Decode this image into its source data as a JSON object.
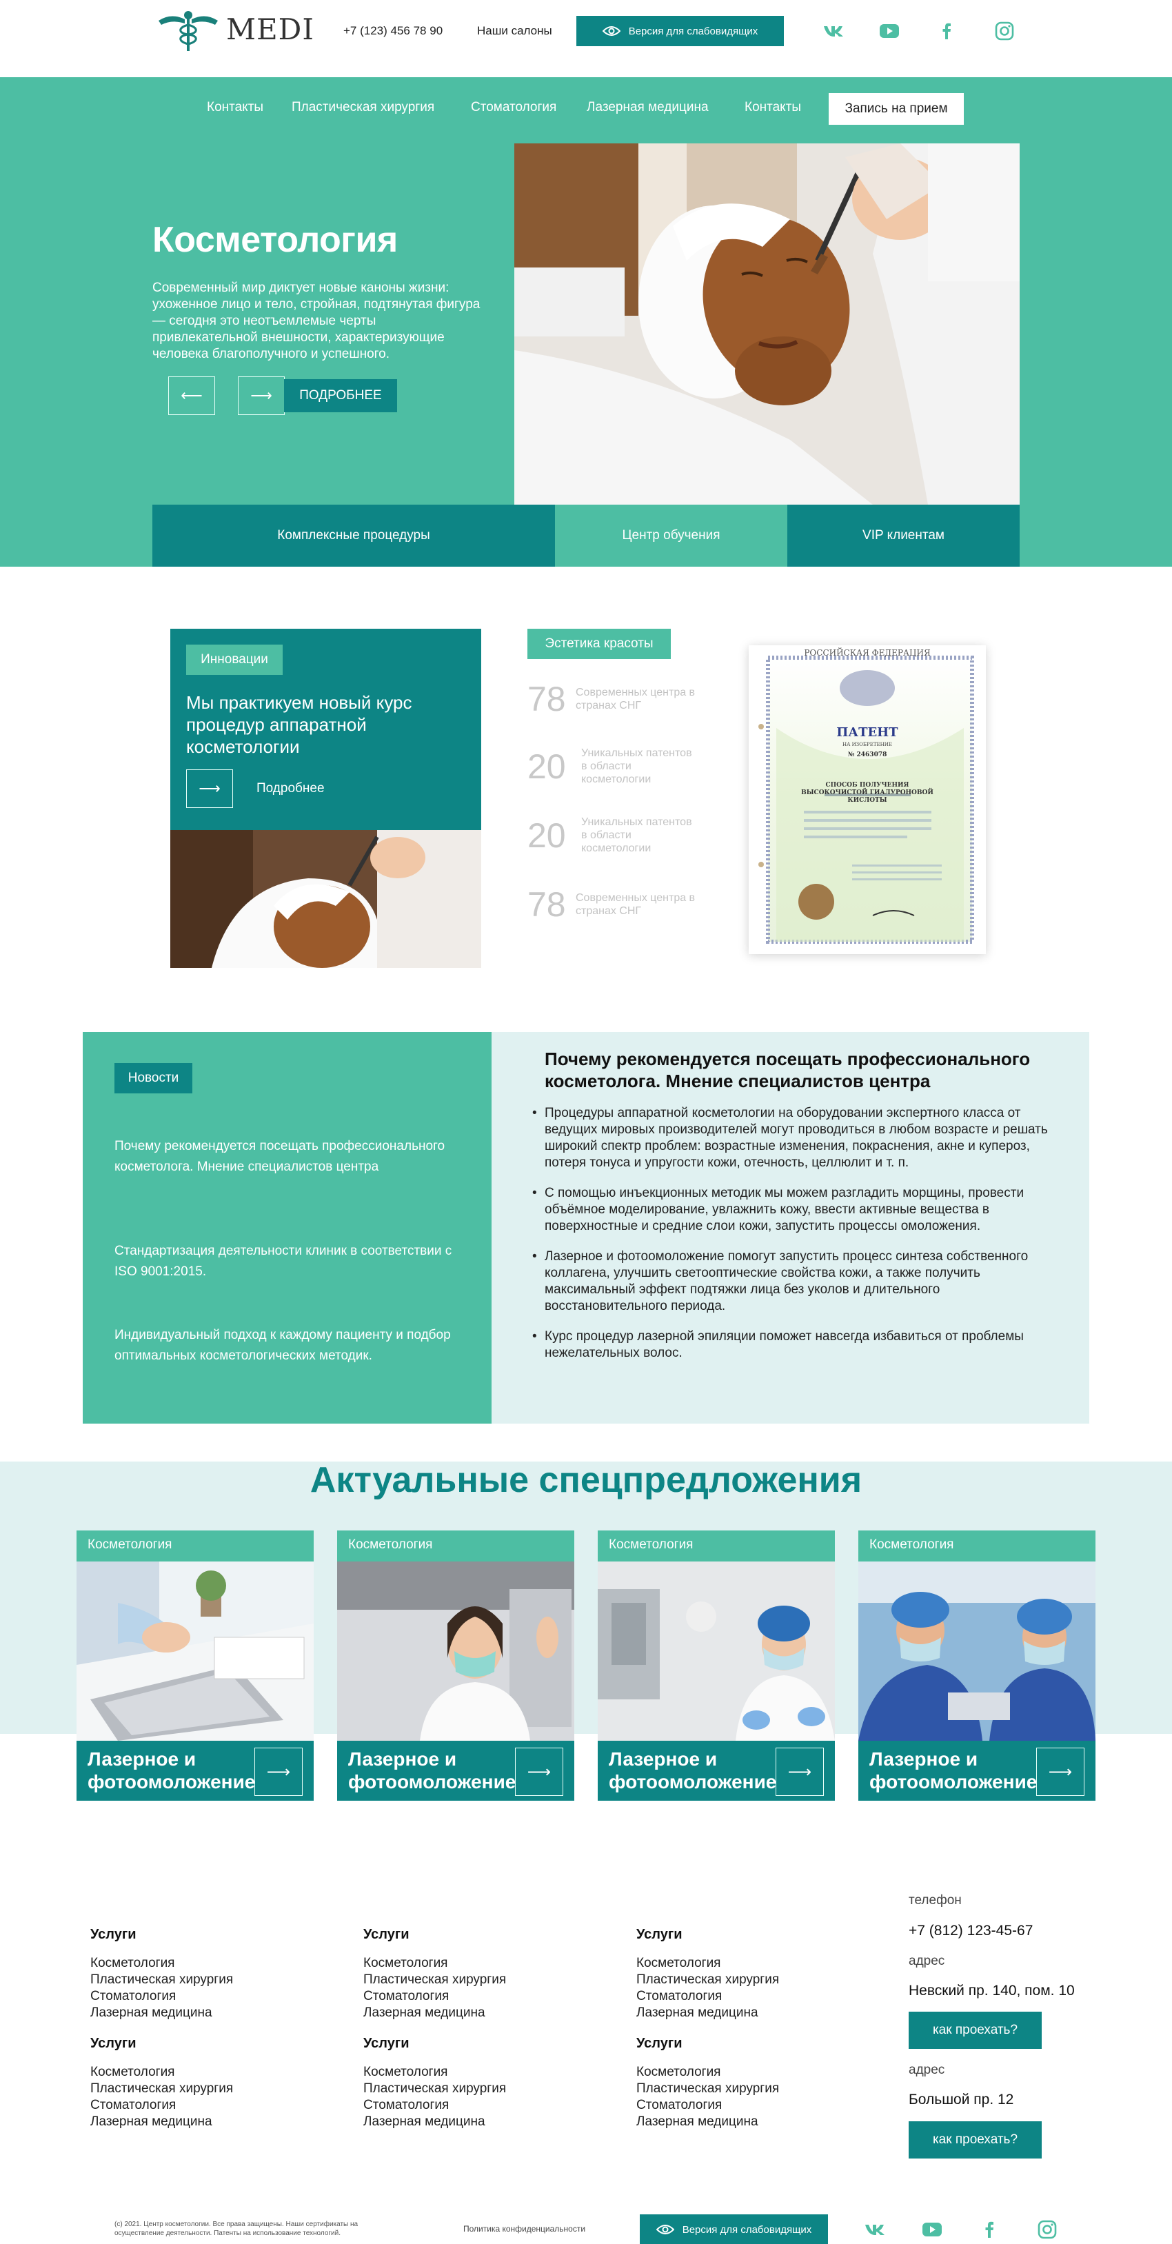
{
  "header": {
    "logo_text": "MEDI",
    "phone": "+7 (123) 456 78 90",
    "salons": "Наши салоны",
    "vision_button": "Версия для слабовидящих",
    "social_icons": [
      "vk-icon",
      "youtube-icon",
      "facebook-icon",
      "instagram-icon"
    ]
  },
  "nav": {
    "items": [
      "Контакты",
      "Пластическая хирургия",
      "Стоматология",
      "Лазерная медицина",
      "Контакты"
    ],
    "cta": "Запись на прием"
  },
  "hero": {
    "title": "Косметология",
    "text": "Современный мир диктует новые каноны жизни: ухоженное лицо и тело, стройная, подтянутая фигура — сегодня это неотъемлемые черты привлекательной внешности, характеризующие человека благополучного и успешного.",
    "prev_arrow": "⟵",
    "next_arrow": "⟶",
    "more_button": "ПОДРОБНЕЕ",
    "tabs": [
      "Комплексные процедуры",
      "Центр обучения",
      "VIP клиентам"
    ]
  },
  "innovations": {
    "badge": "Инновации",
    "title": "Мы практикуем новый курс процедур аппаратной косметологии",
    "arrow": "⟶",
    "more_link": "Подробнее",
    "aesthetics_badge": "Эстетика красоты",
    "stats": [
      {
        "number": "78",
        "label": "Современных центра в странах СНГ"
      },
      {
        "number": "20",
        "label": "Уникальных патентов в области косметологии"
      },
      {
        "number": "20",
        "label": "Уникальных патентов в области косметологии"
      },
      {
        "number": "78",
        "label": "Современных центра в странах СНГ"
      }
    ],
    "patent": {
      "country": "РОССИЙСКАЯ ФЕДЕРАЦИЯ",
      "title": "ПАТЕНТ",
      "subtitle": "НА ИЗОБРЕТЕНИЕ",
      "number": "№ 2463078",
      "invention": "СПОСОБ ПОЛУЧЕНИЯ ВЫСОКОЧИСТОЙ ГИАЛУРОНОВОЙ КИСЛОТЫ"
    }
  },
  "news": {
    "badge": "Новости",
    "items": [
      "Почему рекомендуется посещать профессионального косметолога. Мнение специалистов центра",
      "Стандартизация деятельности клиник в соответствии с ISO 9001:2015.",
      "Индивидуальный подход к каждому пациенту и подбор оптимальных косметологических методик."
    ],
    "heading": "Почему рекомендуется посещать профессионального косметолога. Мнение специалистов центра",
    "bullets": [
      "Процедуры аппаратной косметологии на оборудовании экспертного класса от ведущих мировых производителей могут проводиться в любом возрасте и решать широкий спектр проблем: возрастные изменения, покраснения, акне и купероз, потеря тонуса и упругости кожи, отечность, целлюлит и т. п.",
      "С помощью инъекционных методик мы можем разгладить морщины, провести объёмное моделирование, увлажнить кожу, ввести активные вещества в поверхностные и средние слои кожи, запустить процессы омоложения.",
      "Лазерное и фотоомоложение помогут запустить процесс синтеза собственного коллагена, улучшить светооптические свойства кожи, а также получить максимальный эффект подтяжки лица без уколов и длительного восстановительного периода.",
      "Курс процедур лазерной эпиляции поможет навсегда избавиться от проблемы нежелательных волос."
    ]
  },
  "offers": {
    "title": "Актуальные спецпредложения",
    "cards": [
      {
        "tag": "Косметология",
        "title": "Лазерное и фотоомоложение",
        "arrow": "⟶"
      },
      {
        "tag": "Косметология",
        "title": "Лазерное и фотоомоложение",
        "arrow": "⟶"
      },
      {
        "tag": "Косметология",
        "title": "Лазерное и фотоомоложение",
        "arrow": "⟶"
      },
      {
        "tag": "Косметология",
        "title": "Лазерное и фотоомоложение",
        "arrow": "⟶"
      }
    ]
  },
  "footer": {
    "columns": [
      {
        "heading": "Услуги",
        "items": [
          "Косметология",
          "Пластическая хирургия",
          "Стоматология",
          "Лазерная медицина"
        ]
      },
      {
        "heading": "Услуги",
        "items": [
          "Косметология",
          "Пластическая хирургия",
          "Стоматология",
          "Лазерная медицина"
        ]
      },
      {
        "heading": "Услуги",
        "items": [
          "Косметология",
          "Пластическая хирургия",
          "Стоматология",
          "Лазерная медицина"
        ]
      },
      {
        "heading": "Услуги",
        "items": [
          "Косметология",
          "Пластическая хирургия",
          "Стоматология",
          "Лазерная медицина"
        ]
      },
      {
        "heading": "Услуги",
        "items": [
          "Косметология",
          "Пластическая хирургия",
          "Стоматология",
          "Лазерная медицина"
        ]
      },
      {
        "heading": "Услуги",
        "items": [
          "Косметология",
          "Пластическая хирургия",
          "Стоматология",
          "Лазерная медицина"
        ]
      }
    ],
    "contacts": {
      "phone_label": "телефон",
      "phone": "+7 (812) 123-45-67",
      "address_label_1": "адрес",
      "address_1": "Невский пр. 140, пом. 10",
      "route_button_1": "как проехать?",
      "address_label_2": "адрес",
      "address_2": "Большой пр. 12",
      "route_button_2": "как проехать?"
    },
    "copyright": "(с) 2021. Центр косметологии. Все права защищены. Наши сертификаты на осуществление деятельности. Патенты на использование технологий.",
    "privacy": "Политика конфиденциальности",
    "vision_button": "Версия для слабовидящих"
  },
  "colors": {
    "teal_light": "#4dbea3",
    "teal_dark": "#0d8585",
    "pale_cyan": "#e0f1f1"
  }
}
